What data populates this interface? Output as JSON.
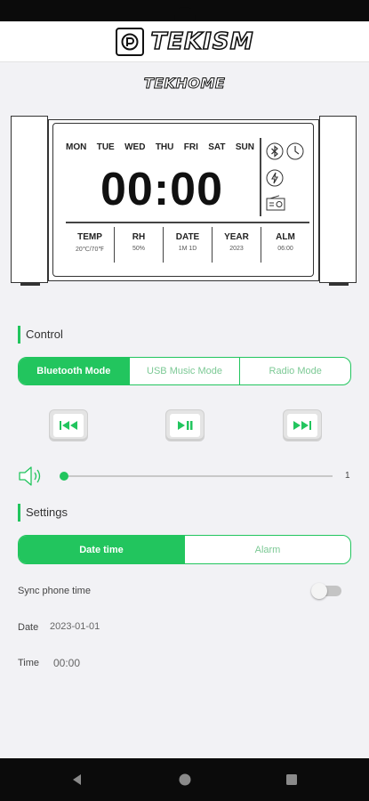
{
  "brand": {
    "name": "TEKISM",
    "sub_name": "TEKHOME"
  },
  "clock_display": {
    "days": [
      "MON",
      "TUE",
      "WED",
      "THU",
      "FRI",
      "SAT",
      "SUN"
    ],
    "time": "00:00",
    "stats": [
      {
        "label": "TEMP",
        "value": "20℃/70℉"
      },
      {
        "label": "RH",
        "value": "50%"
      },
      {
        "label": "DATE",
        "value": "1M 1D"
      },
      {
        "label": "YEAR",
        "value": "2023"
      },
      {
        "label": "ALM",
        "value": "06:00"
      }
    ],
    "icons": [
      "bluetooth-icon",
      "clock-icon",
      "lightning-icon",
      "radio-icon"
    ]
  },
  "control": {
    "title": "Control",
    "modes": [
      "Bluetooth Mode",
      "USB Music Mode",
      "Radio Mode"
    ],
    "active_mode_index": 0,
    "volume_value": "1",
    "volume_level": 0.0
  },
  "settings": {
    "title": "Settings",
    "tabs": [
      "Date time",
      "Alarm"
    ],
    "active_tab_index": 0,
    "sync_label": "Sync phone time",
    "sync_enabled": false,
    "date_label": "Date",
    "date_value": "2023-01-01",
    "time_label": "Time",
    "time_value": "00:00"
  },
  "colors": {
    "accent": "#22c55e",
    "system_bar": "#0b0b0b",
    "background": "#f2f2f5"
  }
}
